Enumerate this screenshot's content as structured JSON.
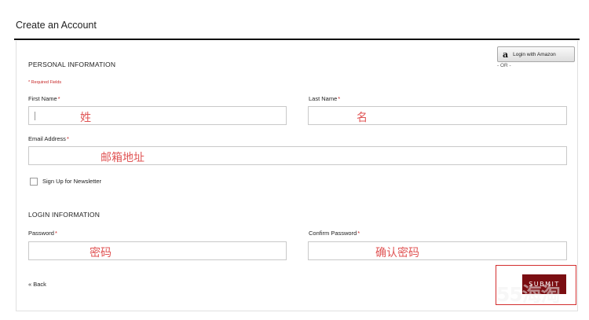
{
  "page": {
    "title": "Create an Account"
  },
  "personal": {
    "heading": "PERSONAL INFORMATION",
    "required_note": "* Required Fields",
    "first_name": {
      "label": "First Name",
      "required_mark": "*",
      "value": "姓"
    },
    "last_name": {
      "label": "Last Name",
      "required_mark": "*",
      "value": "名"
    },
    "email": {
      "label": "Email Address",
      "required_mark": "*",
      "value": "邮箱地址"
    },
    "newsletter": {
      "label": "Sign Up for Newsletter",
      "checked": false
    }
  },
  "amazon": {
    "logo": "a",
    "label": "Login with Amazon",
    "or_text": "- OR -"
  },
  "login": {
    "heading": "LOGIN INFORMATION",
    "password": {
      "label": "Password",
      "required_mark": "*",
      "value": "密码"
    },
    "confirm_password": {
      "label": "Confirm Password",
      "required_mark": "*",
      "value": "确认密码"
    }
  },
  "footer": {
    "back_label": "« Back",
    "submit_label": "SUBMIT"
  },
  "watermark": {
    "text": "55海淘"
  },
  "colors": {
    "required": "#c62828",
    "overlay_text": "#e05555",
    "submit_bg": "#7b0e12",
    "highlight_frame": "#d32f2f"
  }
}
